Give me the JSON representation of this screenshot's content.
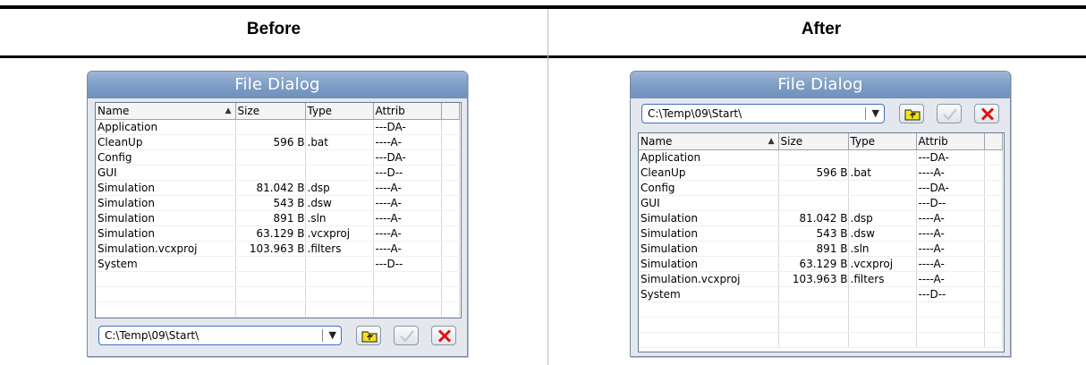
{
  "comparison": {
    "before_label": "Before",
    "after_label": "After"
  },
  "dialog": {
    "title": "File Dialog",
    "path": "C:\\Temp\\09\\Start\\",
    "columns": [
      "Name",
      "Size",
      "Type",
      "Attrib"
    ],
    "rows": [
      {
        "name": "Application",
        "size": "",
        "type": "",
        "attrib": "---DA-"
      },
      {
        "name": "CleanUp",
        "size": "596 B",
        "type": ".bat",
        "attrib": "----A-"
      },
      {
        "name": "Config",
        "size": "",
        "type": "",
        "attrib": "---DA-"
      },
      {
        "name": "GUI",
        "size": "",
        "type": "",
        "attrib": "---D--"
      },
      {
        "name": "Simulation",
        "size": "81.042 B",
        "type": ".dsp",
        "attrib": "----A-"
      },
      {
        "name": "Simulation",
        "size": "543 B",
        "type": ".dsw",
        "attrib": "----A-"
      },
      {
        "name": "Simulation",
        "size": "891 B",
        "type": ".sln",
        "attrib": "----A-"
      },
      {
        "name": "Simulation",
        "size": "63.129 B",
        "type": ".vcxproj",
        "attrib": "----A-"
      },
      {
        "name": "Simulation.vcxproj",
        "size": "103.963 B",
        "type": ".filters",
        "attrib": "----A-"
      },
      {
        "name": "System",
        "size": "",
        "type": "",
        "attrib": "---D--"
      }
    ],
    "icons": {
      "sort": "sort-ascending-icon",
      "dropdown": "chevron-down-icon",
      "up": "folder-up-icon",
      "ok": "checkmark-icon",
      "cancel": "close-icon"
    },
    "colors": {
      "title_bar": "#7c9cc4",
      "combo_border": "#3a6fc4",
      "cancel_red": "#e01010",
      "folder_yellow": "#f4e41c"
    }
  }
}
